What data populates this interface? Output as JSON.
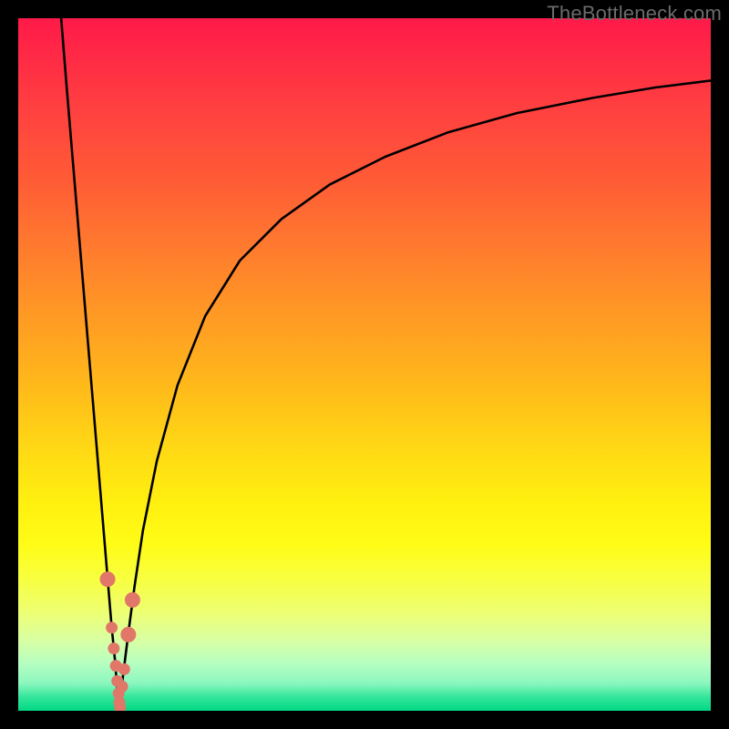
{
  "watermark": "TheBottleneck.com",
  "colors": {
    "curve": "#000000",
    "marker_fill": "#e07768",
    "marker_stroke": "#c65a4c"
  },
  "chart_data": {
    "type": "line",
    "title": "",
    "xlabel": "",
    "ylabel": "",
    "xlim": [
      0,
      100
    ],
    "ylim": [
      0,
      100
    ],
    "grid": false,
    "legend": false,
    "vertex_x": 14.5,
    "series": [
      {
        "name": "left-branch",
        "x": [
          6.2,
          7.0,
          8.0,
          9.0,
          10.0,
          11.0,
          12.0,
          12.5,
          13.0,
          13.5,
          14.0,
          14.3,
          14.5
        ],
        "values": [
          100,
          90,
          78,
          66,
          54,
          42,
          30,
          24,
          18,
          12,
          7,
          3,
          0
        ]
      },
      {
        "name": "right-branch",
        "x": [
          14.5,
          15.0,
          15.5,
          16.0,
          16.8,
          18.0,
          20.0,
          23.0,
          27.0,
          32.0,
          38.0,
          45.0,
          53.0,
          62.0,
          72.0,
          83.0,
          92.0,
          100.0
        ],
        "values": [
          0,
          4,
          8,
          12,
          18,
          26,
          36,
          47,
          57,
          65,
          71,
          76,
          80,
          83.5,
          86.3,
          88.5,
          90.0,
          91.0
        ]
      }
    ],
    "markers": [
      {
        "name": "left-branch-marker",
        "x": 12.9,
        "y": 19
      },
      {
        "name": "right-branch-marker-upper",
        "x": 16.5,
        "y": 16
      },
      {
        "name": "right-branch-marker-lower",
        "x": 15.9,
        "y": 11
      },
      {
        "name": "vertex-cluster-1",
        "x": 13.5,
        "y": 12
      },
      {
        "name": "vertex-cluster-2",
        "x": 13.8,
        "y": 9
      },
      {
        "name": "vertex-cluster-3",
        "x": 14.1,
        "y": 6.5
      },
      {
        "name": "vertex-cluster-4",
        "x": 14.3,
        "y": 4.3
      },
      {
        "name": "vertex-cluster-5",
        "x": 14.5,
        "y": 2.5
      },
      {
        "name": "vertex-cluster-6",
        "x": 14.6,
        "y": 1.2
      },
      {
        "name": "vertex-cluster-7",
        "x": 14.7,
        "y": 0.5
      },
      {
        "name": "vertex-cluster-8",
        "x": 15.0,
        "y": 3.5
      },
      {
        "name": "vertex-cluster-9",
        "x": 15.3,
        "y": 6.0
      }
    ]
  }
}
